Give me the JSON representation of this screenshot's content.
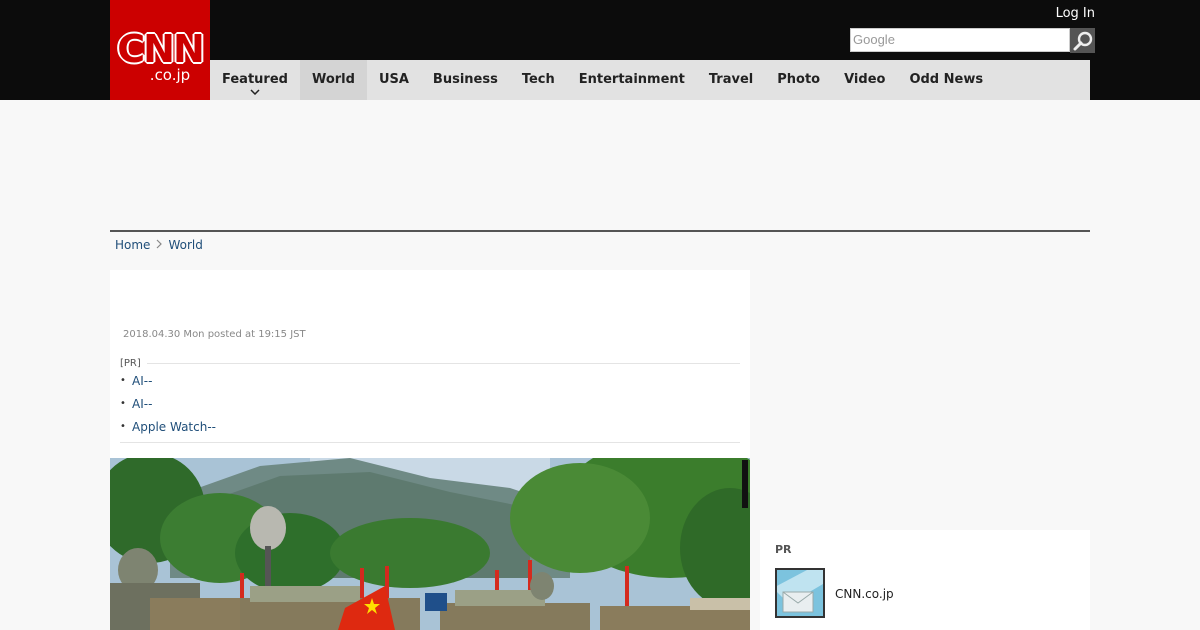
{
  "header": {
    "logo_main": "CNN",
    "logo_sub": ".co.jp",
    "login_label": "Log In",
    "search_placeholder": "Google"
  },
  "nav": {
    "items": [
      {
        "label": "Featured"
      },
      {
        "label": "World"
      },
      {
        "label": "USA"
      },
      {
        "label": "Business"
      },
      {
        "label": "Tech"
      },
      {
        "label": "Entertainment"
      },
      {
        "label": "Travel"
      },
      {
        "label": "Photo"
      },
      {
        "label": "Video"
      },
      {
        "label": "Odd News"
      }
    ],
    "active": "World"
  },
  "breadcrumb": {
    "home": "Home",
    "current": "World"
  },
  "article": {
    "dateline": "2018.04.30 Mon posted at 19:15 JST",
    "pr_heading": "[PR]",
    "pr_links": [
      {
        "label": "AI--"
      },
      {
        "label": "AI--"
      },
      {
        "label": "Apple Watch--"
      }
    ]
  },
  "sidebar": {
    "pr_title": "PR",
    "pr_item_label": "CNN.co.jp"
  },
  "colors": {
    "brand_red": "#cc0000",
    "header_bg": "#0c0c0c",
    "nav_bg": "#e2e2e2",
    "link_blue": "#1f4e79"
  },
  "icons": {
    "search": "search-icon",
    "breadcrumb_separator": "chevron-right-icon",
    "nav_dropdown": "chevron-down-icon"
  }
}
